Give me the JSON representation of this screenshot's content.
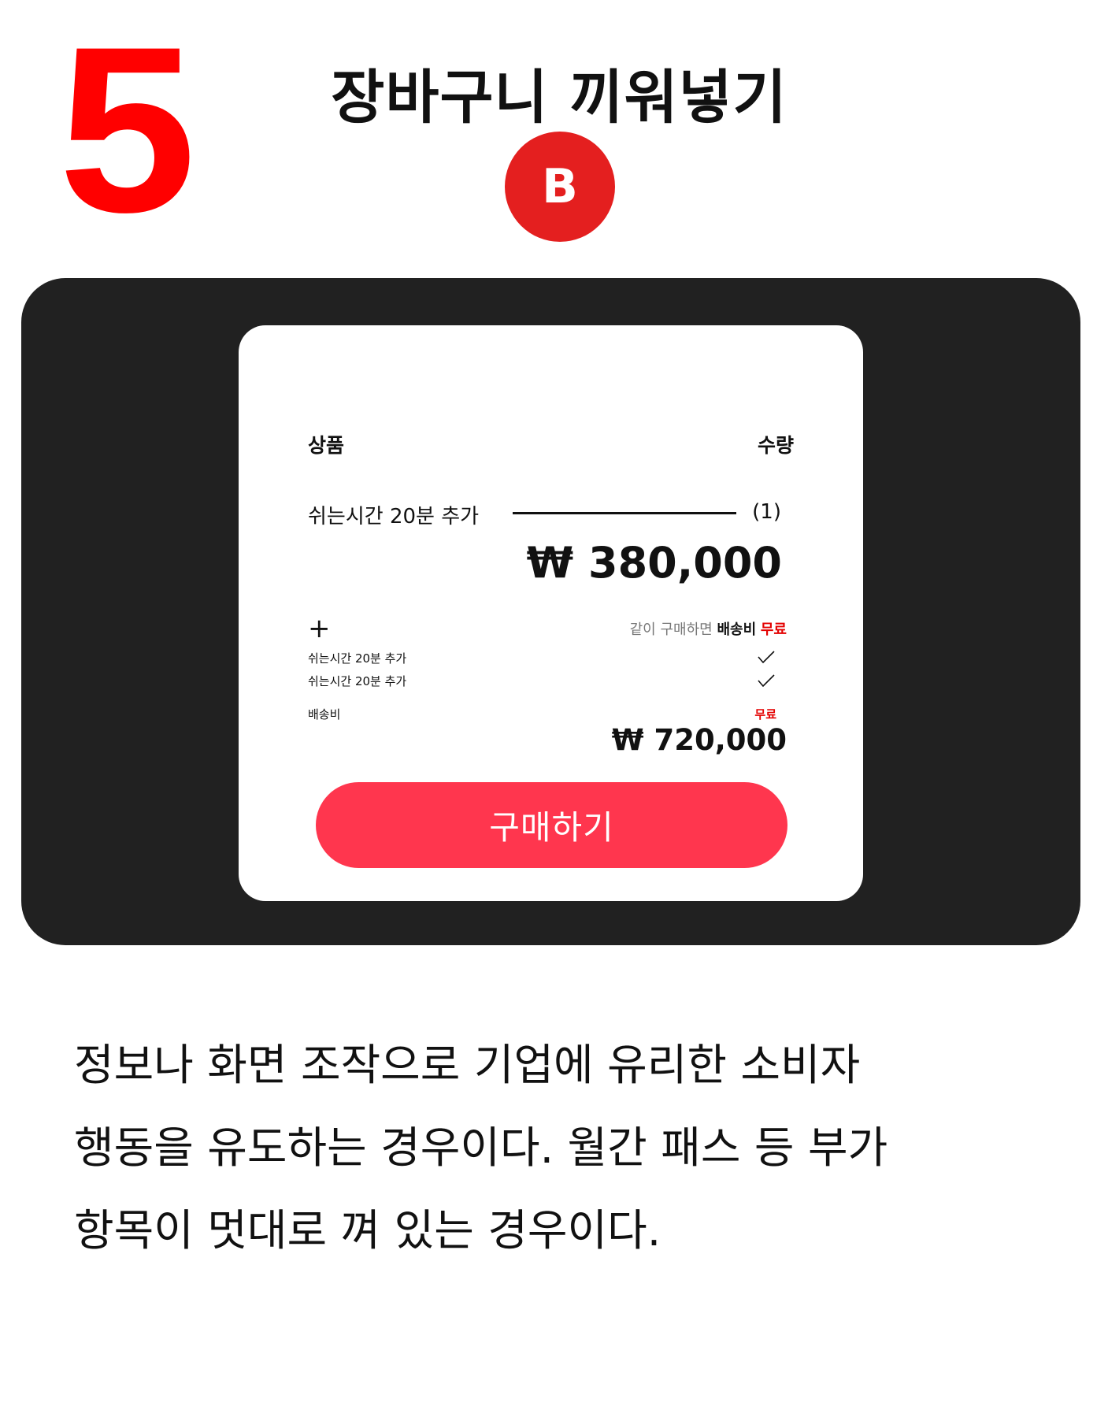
{
  "header": {
    "step_number": "5",
    "title": "장바구니 끼워넣기",
    "badge": "B"
  },
  "cart": {
    "col_product": "상품",
    "col_quantity": "수량",
    "item": {
      "name": "쉬는시간 20분 추가",
      "quantity": "(1)",
      "price": "₩ 380,000"
    },
    "addon": {
      "plus": "+",
      "note_prefix": "같이 구매하면",
      "note_fee": "배송비",
      "note_free": "무료",
      "rows": [
        {
          "label": "쉬는시간 20분 추가",
          "icon": "check-icon"
        },
        {
          "label": "쉬는시간 20분 추가",
          "icon": "check-icon"
        }
      ],
      "shipping_label": "배송비",
      "shipping_value": "무료",
      "total": "₩ 720,000"
    },
    "buy_button": "구매하기"
  },
  "description": {
    "lines": [
      "정보나 화면 조작으로 기업에 유리한 소비자",
      "행동을 유도하는 경우이다. 월간 패스 등 부가",
      "항목이 멋대로 껴 있는 경우이다."
    ]
  },
  "colors": {
    "accent_red": "#ff0000",
    "badge_red": "#e41f1f",
    "button_pink": "#ff364e",
    "panel_dark": "#212121"
  }
}
